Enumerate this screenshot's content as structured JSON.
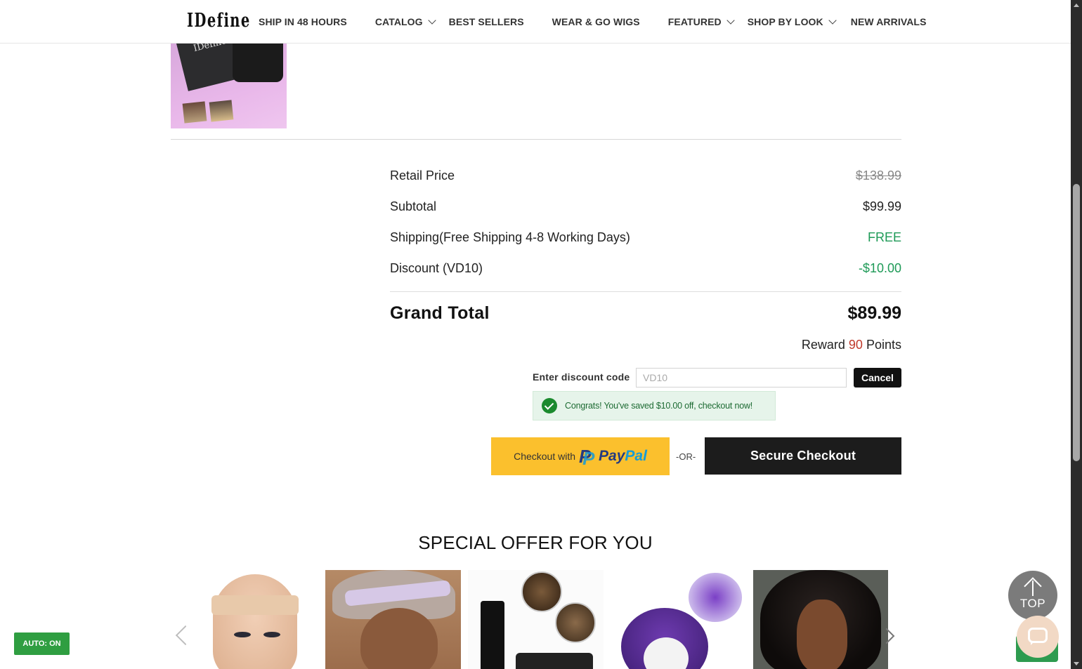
{
  "header": {
    "logo": "IDefine",
    "nav": [
      {
        "label": "SHIP IN 48 HOURS",
        "dropdown": false
      },
      {
        "label": "CATALOG",
        "dropdown": true
      },
      {
        "label": "BEST SELLERS",
        "dropdown": false
      },
      {
        "label": "WEAR & GO WIGS",
        "dropdown": false
      },
      {
        "label": "FEATURED",
        "dropdown": true
      },
      {
        "label": "SHOP BY LOOK",
        "dropdown": true
      },
      {
        "label": "NEW ARRIVALS",
        "dropdown": false
      }
    ]
  },
  "summary": {
    "retail_label": "Retail Price",
    "retail_value": "$138.99",
    "subtotal_label": "Subtotal",
    "subtotal_value": "$99.99",
    "shipping_label": "Shipping(Free Shipping 4-8 Working Days)",
    "shipping_value": "FREE",
    "discount_label": "Discount (VD10)",
    "discount_value": "-$10.00",
    "grand_label": "Grand Total",
    "grand_value": "$89.99",
    "reward_prefix": "Reward",
    "reward_points": "90",
    "reward_suffix": "Points"
  },
  "discount": {
    "label": "Enter discount code",
    "input_value": "VD10",
    "cancel_label": "Cancel",
    "success_message": "Congrats! You've saved $10.00 off, checkout now!"
  },
  "checkout": {
    "paypal_prefix": "Checkout with",
    "paypal_pay": "Pay",
    "paypal_pal": "Pal",
    "or_label": "-OR-",
    "secure_label": "Secure Checkout"
  },
  "special_offer": {
    "title": "SPECIAL OFFER FOR YOU"
  },
  "floating": {
    "top_label": "TOP",
    "auto_label": "AUTO: ON"
  },
  "colors": {
    "accent_green": "#1e9a57",
    "reward_red": "#c0392b",
    "paypal_yellow": "#fbc02d",
    "checkout_dark": "#1c1c1c"
  },
  "icons": [
    "chevron-down-icon",
    "check-circle-icon",
    "paypal-logo-icon",
    "arrow-left-icon",
    "arrow-right-icon",
    "arrow-up-icon",
    "chat-icon"
  ]
}
